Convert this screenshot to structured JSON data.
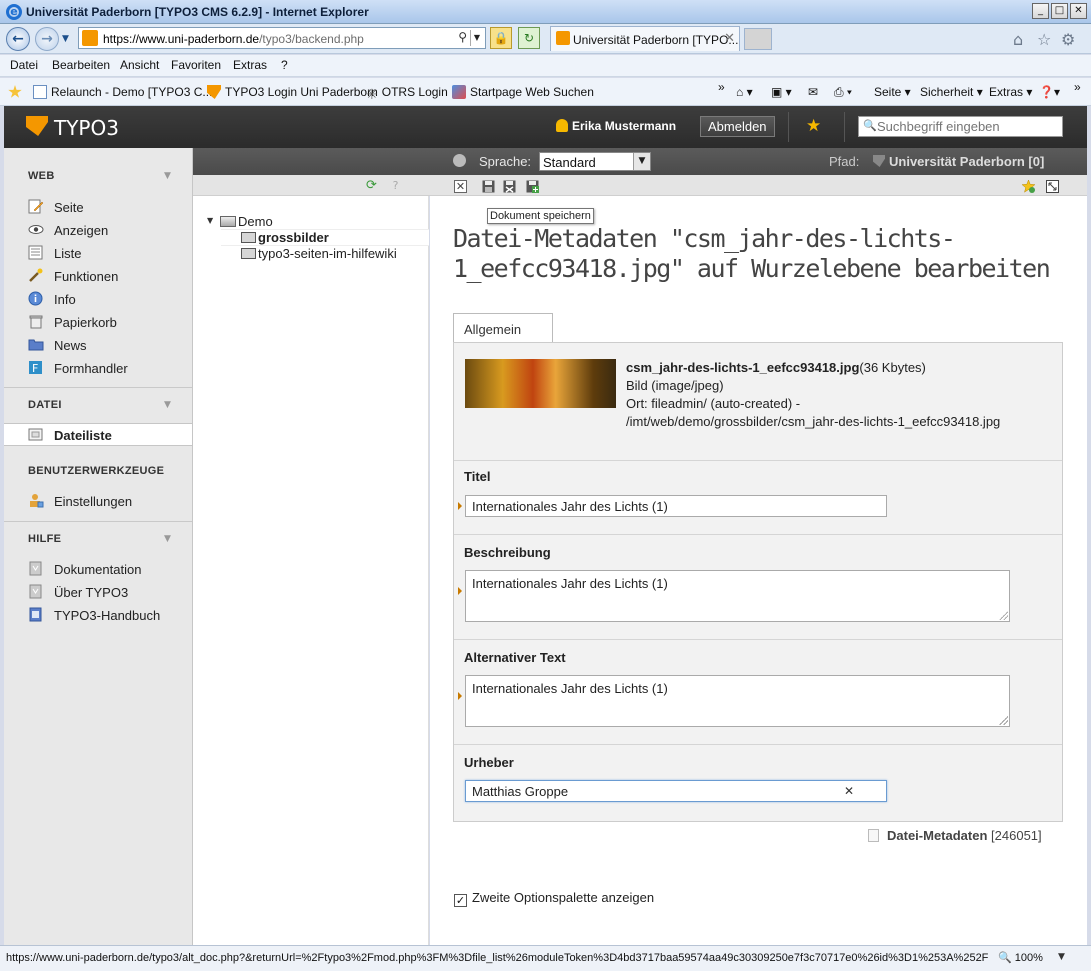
{
  "window": {
    "title": "Universität Paderborn [TYPO3 CMS 6.2.9] - Internet Explorer",
    "controls": [
      "_",
      "□",
      "✕"
    ]
  },
  "browser": {
    "url_host": "https://www.uni-paderborn.de",
    "url_path": "/typo3/backend.php",
    "tab_label": "Universität Paderborn [TYPO...",
    "menu": [
      "Datei",
      "Bearbeiten",
      "Ansicht",
      "Favoriten",
      "Extras",
      "?"
    ],
    "favorites": [
      "Relaunch - Demo [TYPO3 C...",
      "TYPO3 Login Uni Paderborn",
      "OTRS  Login",
      "Startpage Web Suchen"
    ],
    "commands": [
      "Seite ▾",
      "Sicherheit ▾",
      "Extras ▾"
    ],
    "status_url": "https://www.uni-paderborn.de/typo3/alt_doc.php?&returnUrl=%2Ftypo3%2Fmod.php%3FM%3Dfile_list%26moduleToken%3D4bd3717baa59574aa49c30309250e7f3c70717e0%26id%3D1%253A%252F",
    "zoom": "100%"
  },
  "typo3": {
    "logo": "TYPO3",
    "user": "Erika Mustermann",
    "logout": "Abmelden",
    "search_placeholder": "Suchbegriff eingeben"
  },
  "modules": {
    "web_title": "WEB",
    "web_items": [
      "Seite",
      "Anzeigen",
      "Liste",
      "Funktionen",
      "Info",
      "Papierkorb",
      "News",
      "Formhandler"
    ],
    "datei_title": "DATEI",
    "datei_items": [
      "Dateiliste"
    ],
    "user_title": "BENUTZERWERKZEUGE",
    "user_items": [
      "Einstellungen"
    ],
    "hilfe_title": "HILFE",
    "hilfe_items": [
      "Dokumentation",
      "Über TYPO3",
      "TYPO3-Handbuch"
    ]
  },
  "docheader": {
    "language_label": "Sprache:",
    "language_value": "Standard",
    "path_label": "Pfad:",
    "path_value": "Universität Paderborn [0]",
    "tooltip": "Dokument speichern"
  },
  "tree": {
    "root": "Demo",
    "children": [
      "grossbilder",
      "typo3-seiten-im-hilfewiki"
    ]
  },
  "form": {
    "title": "Datei-Metadaten \"csm_jahr-des-lichts-1_eefcc93418.jpg\" auf Wurzelebene bearbeiten",
    "tab": "Allgemein",
    "file_name": "csm_jahr-des-lichts-1_eefcc93418.jpg",
    "file_size": "(36 Kbytes)",
    "file_type": "Bild (image/jpeg)",
    "file_location_1": "Ort: fileadmin/ (auto-created) -",
    "file_location_2": "/imt/web/demo/grossbilder/csm_jahr-des-lichts-1_eefcc93418.jpg",
    "fields": {
      "title_label": "Titel",
      "title_value": "Internationales Jahr des Lichts (1)",
      "description_label": "Beschreibung",
      "description_value": "Internationales Jahr des Lichts (1)",
      "alt_label": "Alternativer Text",
      "alt_value": "Internationales Jahr des Lichts (1)",
      "creator_label": "Urheber",
      "creator_value": "Matthias Groppe"
    },
    "record_label": "Datei-Metadaten",
    "record_id": "[246051]",
    "second_options": "Zweite Optionspalette anzeigen"
  }
}
